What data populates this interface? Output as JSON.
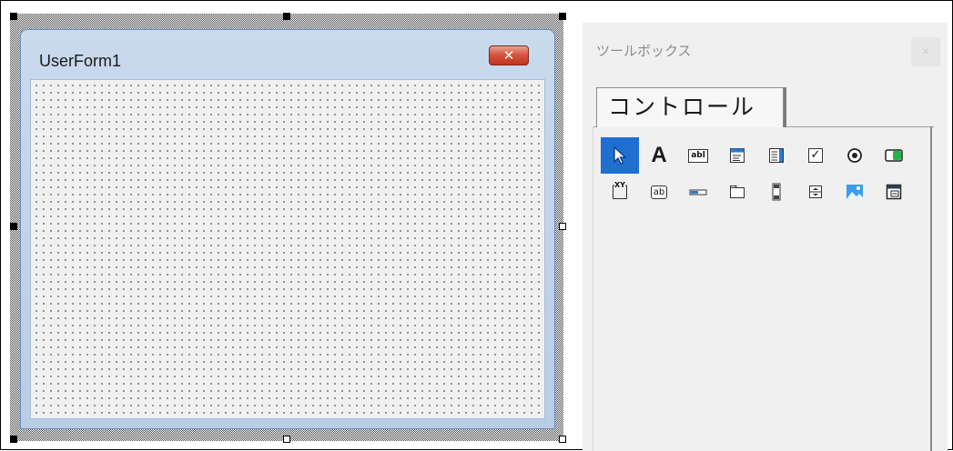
{
  "userform": {
    "title": "UserForm1",
    "close_glyph": "✕"
  },
  "toolbox": {
    "title": "ツールボックス",
    "close_glyph": "×",
    "tab_label": "コントロール",
    "tools": [
      {
        "name": "select-objects-tool",
        "icon": "pointer-arrow-icon",
        "selected": true
      },
      {
        "name": "label-tool",
        "icon": "label-a-icon",
        "glyph": "A"
      },
      {
        "name": "textbox-tool",
        "icon": "textbox-abl-icon",
        "glyph": "abl"
      },
      {
        "name": "combobox-tool",
        "icon": "combobox-icon"
      },
      {
        "name": "listbox-tool",
        "icon": "listbox-icon"
      },
      {
        "name": "checkbox-tool",
        "icon": "checkbox-icon",
        "glyph": "✓"
      },
      {
        "name": "optionbutton-tool",
        "icon": "option-button-icon"
      },
      {
        "name": "togglebutton-tool",
        "icon": "toggle-button-icon"
      },
      {
        "name": "frame-tool",
        "icon": "frame-xy-icon",
        "glyph": "XY"
      },
      {
        "name": "commandbutton-tool",
        "icon": "command-button-ab-icon",
        "glyph": "ab"
      },
      {
        "name": "tabstrip-tool",
        "icon": "tabstrip-icon"
      },
      {
        "name": "multipage-tool",
        "icon": "multipage-icon"
      },
      {
        "name": "scrollbar-tool",
        "icon": "scrollbar-icon"
      },
      {
        "name": "spinbutton-tool",
        "icon": "spinbutton-icon"
      },
      {
        "name": "image-tool",
        "icon": "image-picture-icon"
      },
      {
        "name": "refedit-tool",
        "icon": "refedit-icon"
      }
    ]
  },
  "colors": {
    "selected_tool_bg": "#1f6fd1",
    "form_client_bg": "#f0f0f0",
    "form_title_gradient_top": "#c9daee",
    "close_button_red": "#c1341d",
    "toolbox_bg": "#f0f0f0"
  }
}
